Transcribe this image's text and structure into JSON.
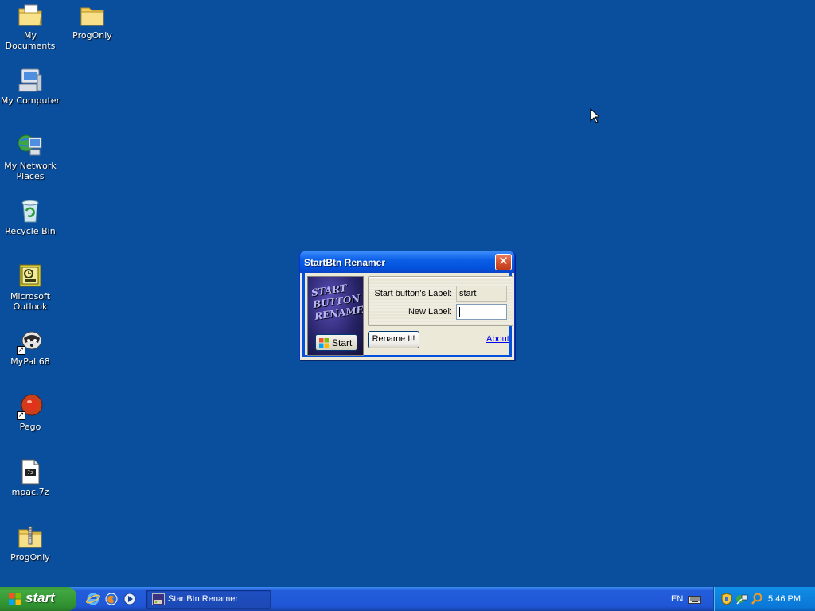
{
  "desktop": {
    "background_color": "#0a4f9e",
    "icons": [
      {
        "label": "My Documents",
        "icon": "my-documents-icon"
      },
      {
        "label": "ProgOnly",
        "icon": "folder-icon"
      },
      {
        "label": "My Computer",
        "icon": "my-computer-icon"
      },
      {
        "label": "My Network Places",
        "icon": "network-places-icon"
      },
      {
        "label": "Recycle Bin",
        "icon": "recycle-bin-icon"
      },
      {
        "label": "Microsoft Outlook",
        "icon": "outlook-icon"
      },
      {
        "label": "MyPal 68",
        "icon": "mypal-icon"
      },
      {
        "label": "Pego",
        "icon": "pego-icon"
      },
      {
        "label": "mpac.7z",
        "icon": "archive-file-icon"
      },
      {
        "label": "ProgOnly",
        "icon": "zip-folder-icon"
      }
    ]
  },
  "dialog": {
    "title": "StartBtn Renamer",
    "close_label": "✕",
    "logo_lines": [
      "START",
      "BUTTON",
      "RENAMER"
    ],
    "logo_button_label": "Start",
    "current_label_caption": "Start button's Label:",
    "current_label_value": "start",
    "new_label_caption": "New Label:",
    "new_label_value": "",
    "rename_button": "Rename It!",
    "about_link": "About"
  },
  "taskbar": {
    "start_label": "start",
    "quick_launch": [
      "internet-explorer-icon",
      "firefox-icon",
      "media-player-icon"
    ],
    "task_button_label": "StartBtn Renamer",
    "language": "EN",
    "clock": "5:46 PM",
    "tray_icons": [
      "security-shield-icon",
      "network-icon",
      "search-icon"
    ]
  },
  "colors": {
    "desktop": "#0a4f9e",
    "taskbar": "#245edb",
    "start_green": "#3c9b3c",
    "titlebar_blue": "#0a5fe6",
    "close_red": "#d6542f"
  }
}
